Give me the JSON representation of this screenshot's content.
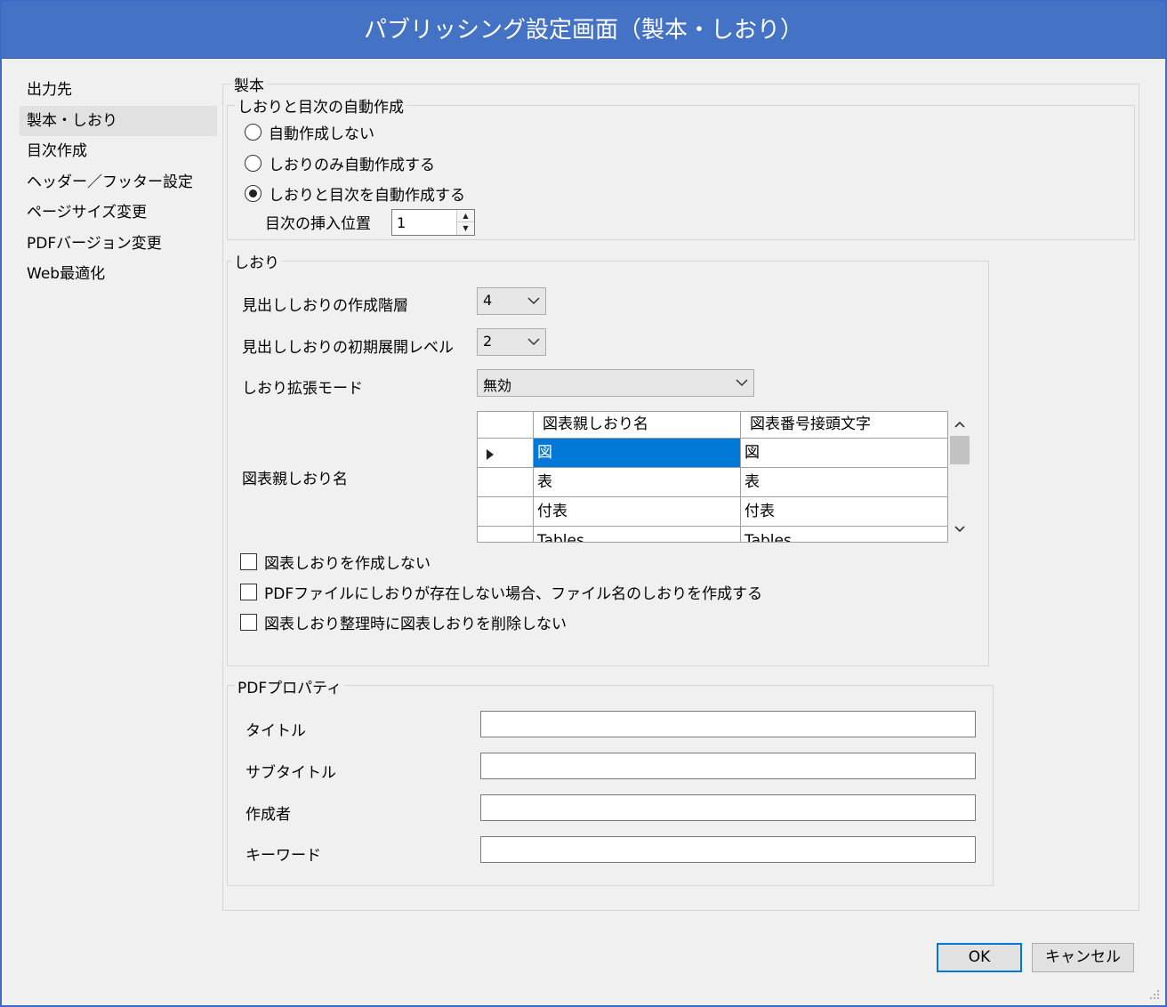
{
  "window": {
    "title": "パブリッシング設定画面（製本・しおり）"
  },
  "nav": {
    "items": [
      {
        "label": "出力先"
      },
      {
        "label": "製本・しおり",
        "selected": true
      },
      {
        "label": "目次作成"
      },
      {
        "label": "ヘッダー／フッター設定"
      },
      {
        "label": "ページサイズ変更"
      },
      {
        "label": "PDFバージョン変更"
      },
      {
        "label": "Web最適化"
      }
    ]
  },
  "binding": {
    "title": "製本",
    "auto": {
      "title": "しおりと目次の自動作成",
      "options": [
        {
          "label": "自動作成しない",
          "checked": false
        },
        {
          "label": "しおりのみ自動作成する",
          "checked": false
        },
        {
          "label": "しおりと目次を自動作成する",
          "checked": true
        }
      ],
      "toc_position_label": "目次の挿入位置",
      "toc_position_value": "1"
    },
    "bookmark": {
      "title": "しおり",
      "heading_level_label": "見出ししおりの作成階層",
      "heading_level_value": "4",
      "initial_expand_label": "見出ししおりの初期展開レベル",
      "initial_expand_value": "2",
      "extend_mode_label": "しおり拡張モード",
      "extend_mode_value": "無効",
      "figure_parent_label": "図表親しおり名",
      "grid": {
        "headers": [
          "図表親しおり名",
          "図表番号接頭文字"
        ],
        "rows": [
          [
            "図",
            "図"
          ],
          [
            "表",
            "表"
          ],
          [
            "付表",
            "付表"
          ],
          [
            "Tables",
            "Tables"
          ]
        ]
      },
      "checkboxes": [
        {
          "label": "図表しおりを作成しない",
          "checked": false
        },
        {
          "label": "PDFファイルにしおりが存在しない場合、ファイル名のしおりを作成する",
          "checked": false
        },
        {
          "label": "図表しおり整理時に図表しおりを削除しない",
          "checked": false
        }
      ]
    },
    "pdf_props": {
      "title": "PDFプロパティ",
      "fields": [
        {
          "label": "タイトル",
          "value": ""
        },
        {
          "label": "サブタイトル",
          "value": ""
        },
        {
          "label": "作成者",
          "value": ""
        },
        {
          "label": "キーワード",
          "value": ""
        }
      ]
    }
  },
  "buttons": {
    "ok": "OK",
    "cancel": "キャンセル"
  },
  "colors": {
    "titlebar": "#4472c4",
    "selection": "#0078d7",
    "background": "#f0f0f0"
  }
}
